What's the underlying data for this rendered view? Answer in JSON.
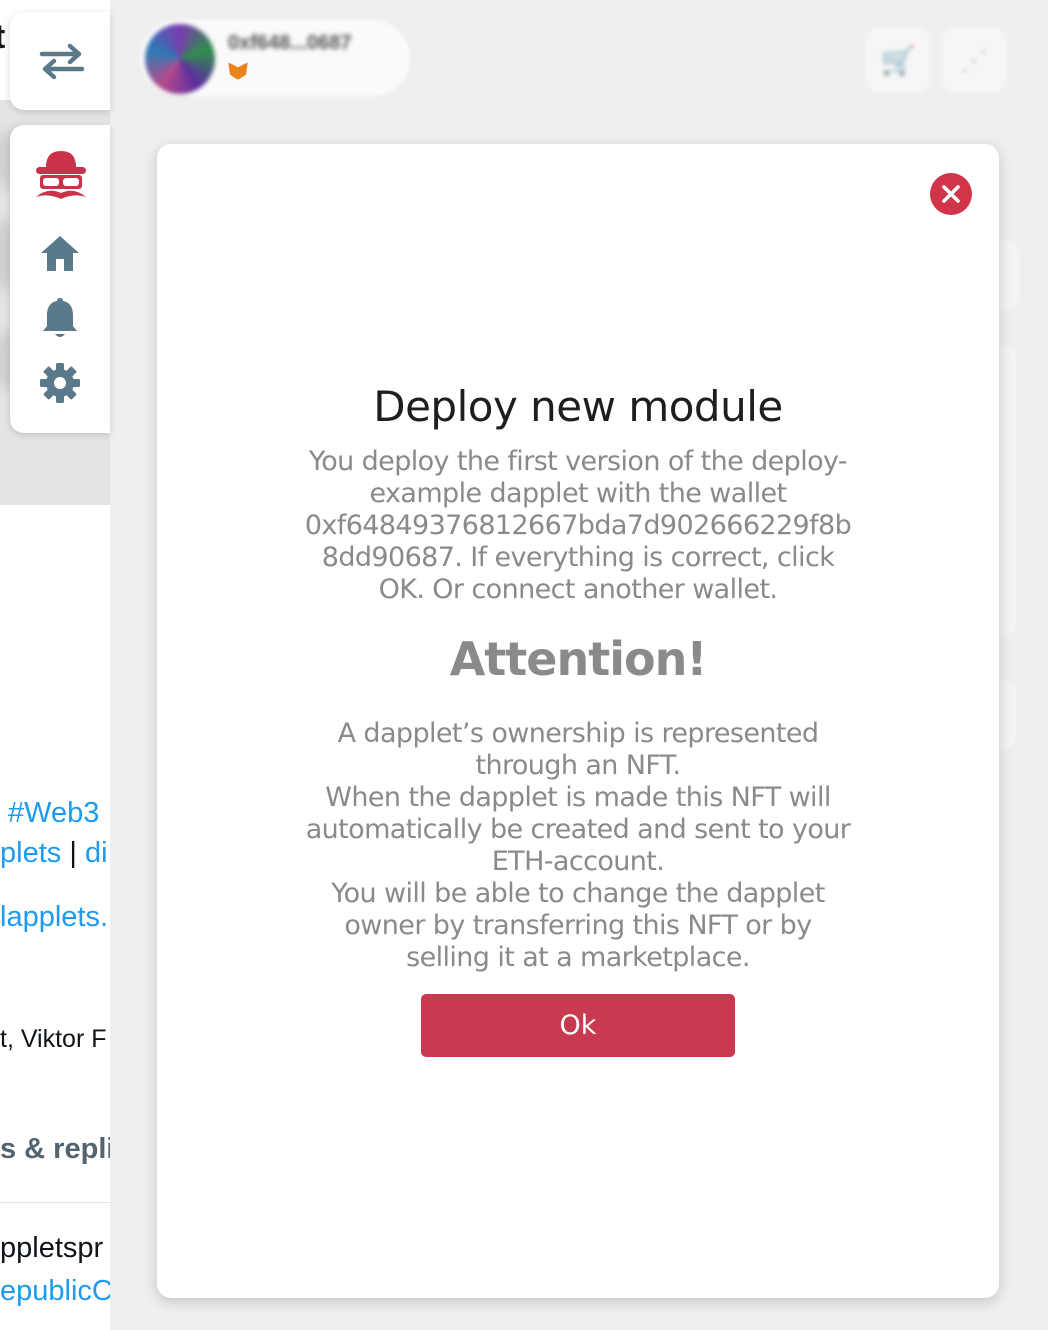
{
  "background_page": {
    "top_char": "t",
    "links": [
      "#Web3",
      "plets",
      "di",
      "lapplets."
    ],
    "separator": "|",
    "text_names": "t, Viktor F",
    "tab_label": "s & repli",
    "handle_1": "ppletspr",
    "handle_2": "epublicC"
  },
  "header": {
    "wallet_address": "0xf648...0687",
    "wallet_icon": "metamask-fox-icon",
    "buttons": [
      {
        "icon": "cart-icon",
        "glyph": "🛒"
      },
      {
        "icon": "share-icon",
        "glyph": "⋰"
      }
    ]
  },
  "sidebar": {
    "toggle_icon": "swap-arrows-icon",
    "items": [
      {
        "icon": "dapplets-logo-icon"
      },
      {
        "icon": "home-icon"
      },
      {
        "icon": "bell-icon"
      },
      {
        "icon": "gear-icon"
      }
    ]
  },
  "modal": {
    "title": "Deploy new module",
    "description_lines": [
      "You deploy the first version of the deploy-",
      "example dapplet with the wallet",
      "0xf64849376812667bda7d902666229f8b",
      "8dd90687. If everything is correct, click",
      "OK. Or connect another wallet."
    ],
    "attention_title": "Attention!",
    "attention_lines": [
      "A dapplet’s ownership is represented",
      "through an NFT.",
      "When the dapplet is made this NFT will",
      "automatically be created and sent to your",
      "ETH-account.",
      "You will be able to change the dapplet",
      "owner by transferring this NFT or by",
      "selling it at a marketplace."
    ],
    "ok_label": "Ok",
    "close_icon": "close-icon"
  },
  "colors": {
    "accent": "#d0354a",
    "ok_button": "#c83a4f",
    "nav_icon": "#5a7a8c",
    "muted_text": "#8a8a8a",
    "link": "#1d9bf0"
  }
}
